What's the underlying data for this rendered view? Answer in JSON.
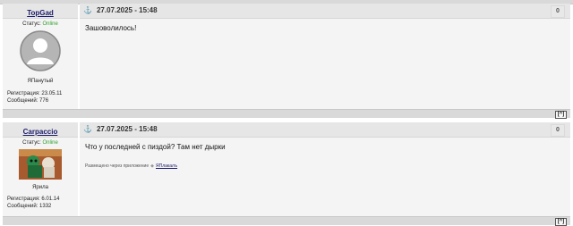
{
  "posts": [
    {
      "username": "TopGad",
      "status_label": "Статус:",
      "status_value": "Online",
      "rank": "ЯПанутый",
      "reg_label": "Регистрация:",
      "reg_value": "23.05.11",
      "msg_label": "Сообщений:",
      "msg_value": "776",
      "date": "27.07.2025 - 15:48",
      "number": "0",
      "text": "Зашоволилось!",
      "via_text": "",
      "via_link": "",
      "top_label": "[^]"
    },
    {
      "username": "Carpaccio",
      "status_label": "Статус:",
      "status_value": "Online",
      "rank": "Ярила",
      "reg_label": "Регистрация:",
      "reg_value": "6.01.14",
      "msg_label": "Сообщений:",
      "msg_value": "1332",
      "date": "27.07.2025 - 15:48",
      "number": "0",
      "text": "Что у последней с пиздой? Там нет дырки",
      "via_text": "Размещено через приложение",
      "via_link": "ЯПлакалъ",
      "top_label": "[^]"
    }
  ],
  "colors": {
    "online": "#2fa12f",
    "username": "#1a1a6a",
    "anchor": "#2b78c4"
  }
}
